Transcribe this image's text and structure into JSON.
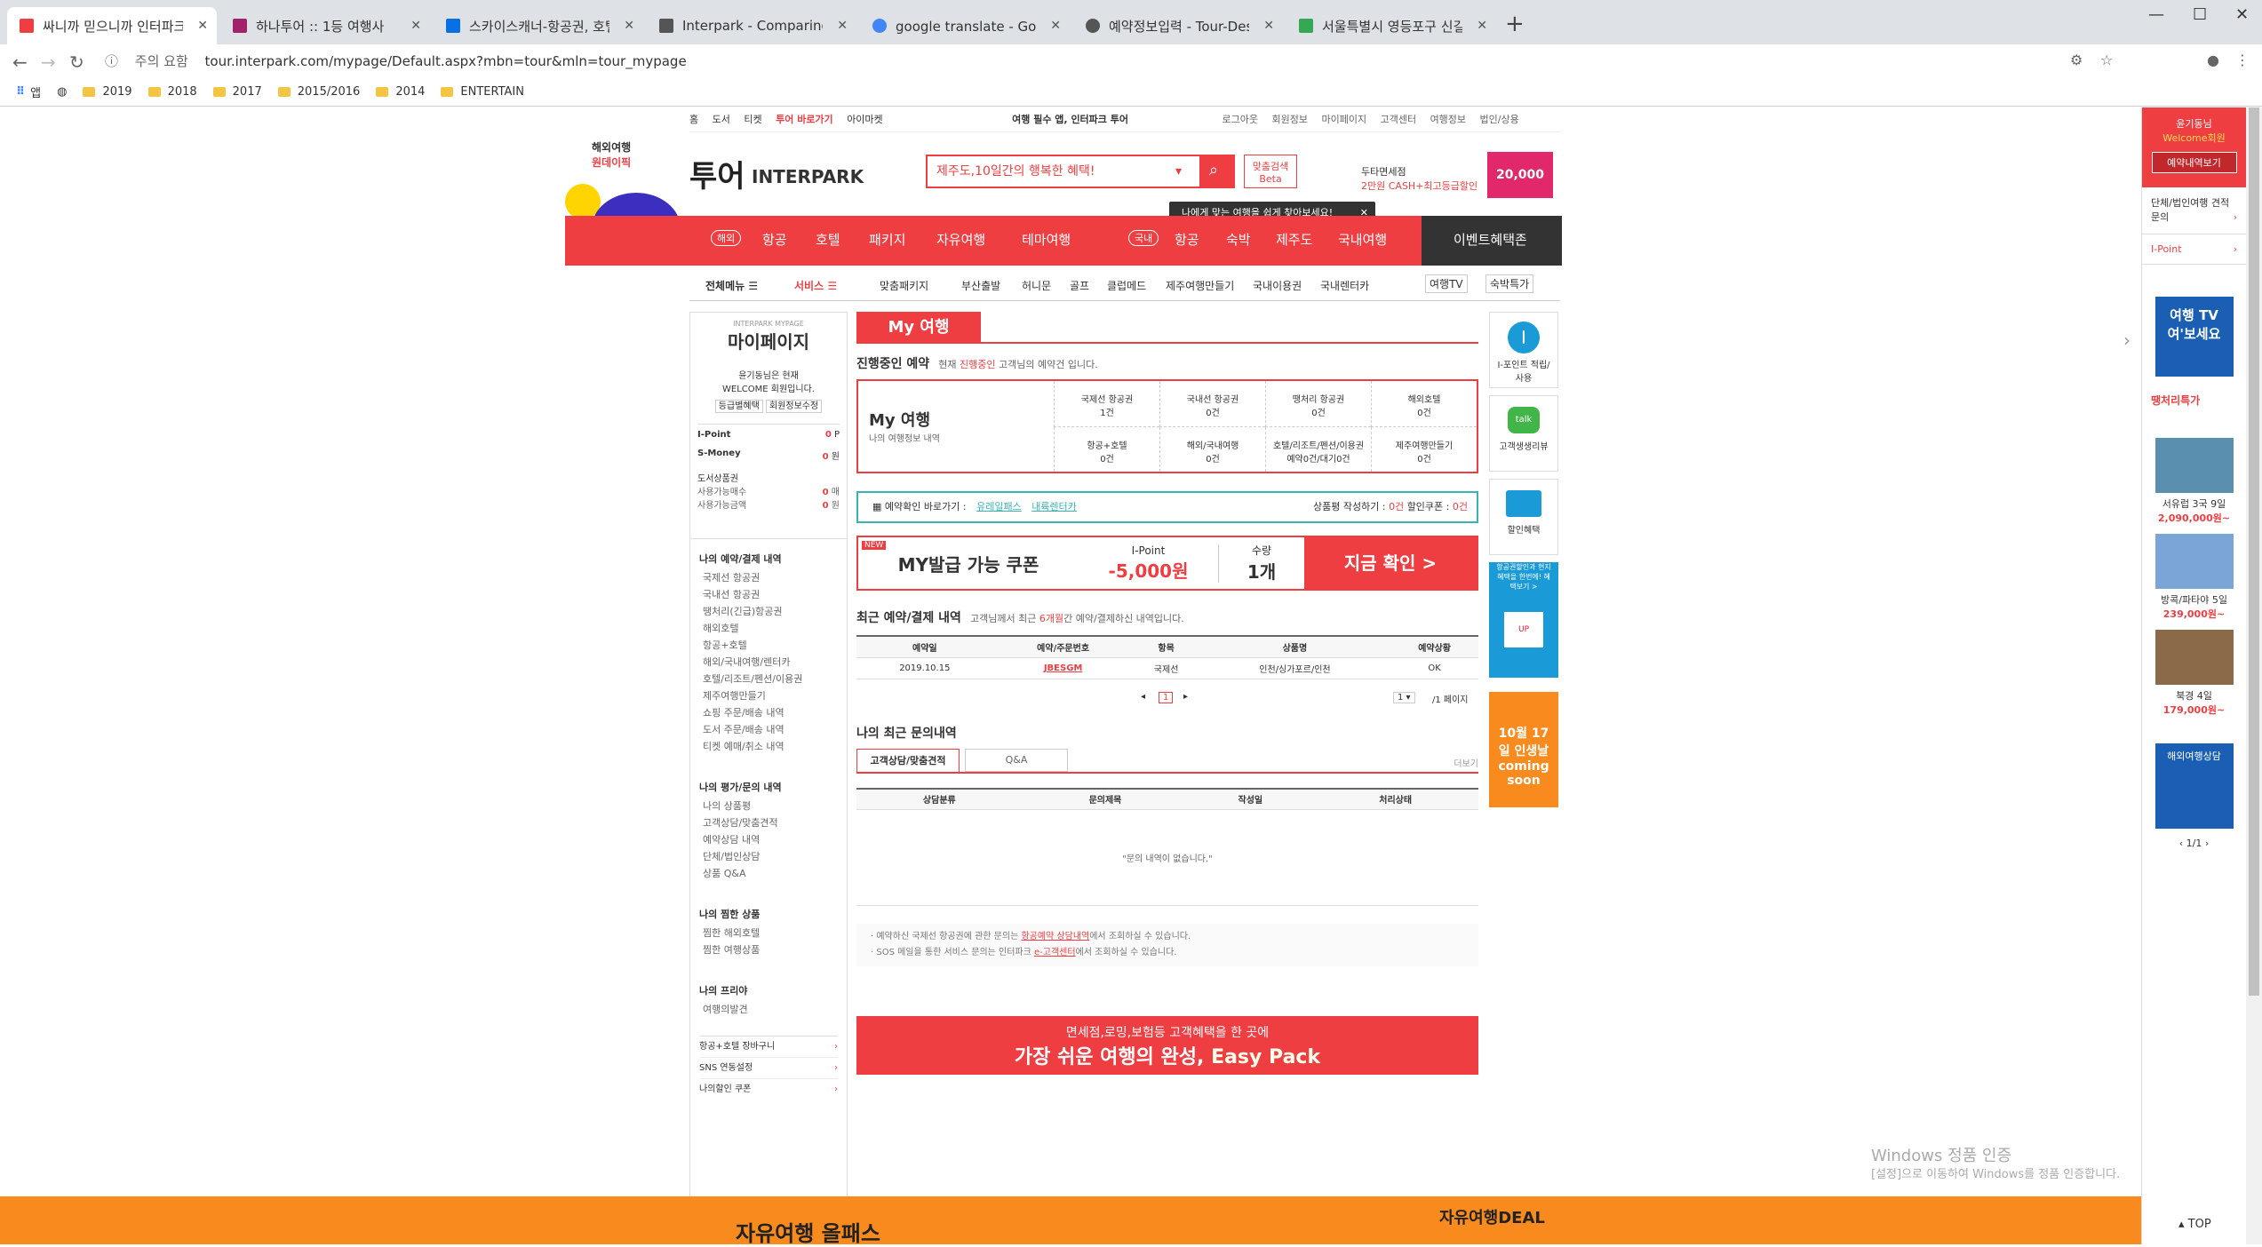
{
  "tabs": [
    {
      "title": "싸니까 믿으니까 인터파크 투어",
      "color": "#ef3e42"
    },
    {
      "title": "하나투어 :: 1등 여행사",
      "color": "#a3206a"
    },
    {
      "title": "스카이스캐너-항공권, 호텔, 렌트",
      "color": "#0770e3"
    },
    {
      "title": "Interpark - Comparing the figur",
      "color": "#555555"
    },
    {
      "title": "google translate - Google 검색",
      "color": "#4285f4"
    },
    {
      "title": "예약정보입력 - Tour-Desktop",
      "color": "#555555"
    },
    {
      "title": "서울특별시 영등포구 신길7동 여",
      "color": "#34a853"
    }
  ],
  "omnibar": {
    "warning": "주의 요함",
    "url": "tour.interpark.com/mypage/Default.aspx?mbn=tour&mln=tour_mypage"
  },
  "bookmarks": [
    "앱",
    "2019",
    "2018",
    "2017",
    "2015/2016",
    "2014",
    "ENTERTAIN"
  ],
  "topbar": {
    "left": [
      "홈",
      "도서",
      "티켓",
      "투어 바로가기",
      "아이마켓"
    ],
    "center": "여행 필수 앱, 인터파크 투어",
    "right": [
      "로그아웃",
      "회원정보",
      "마이페이지",
      "고객센터",
      "여행정보",
      "법인/상용"
    ]
  },
  "header": {
    "logo_text": "투어",
    "brand": "INTERPARK",
    "badge_top": "해외여행",
    "badge_bottom": "원데이픽",
    "search_placeholder": "제주도,10일간의 행복한 혜택!",
    "custom_search": "맞춤검색",
    "beta": "Beta",
    "tooltip": "나에게 맞는 여행을 쉽게 찾아보세요!",
    "promo1": "두타면세점",
    "promo2": "2만원 CASH+최고등급할인",
    "promo_amount": "20,000"
  },
  "mainmenu": {
    "overseas_tag": "해외",
    "overseas": [
      "항공",
      "호텔",
      "패키지",
      "자유여행",
      "테마여행"
    ],
    "domestic_tag": "국내",
    "domestic": [
      "항공",
      "숙박",
      "제주도",
      "국내여행"
    ],
    "event": "이벤트혜택존"
  },
  "submenu": {
    "all": "전체메뉴",
    "service": "서비스",
    "items": [
      "맞춤패키지",
      "부산출발",
      "허니문",
      "골프",
      "클럽메드",
      "제주여행만들기",
      "국내이용권",
      "국내렌터카"
    ],
    "tv": "여행TV",
    "stay": "숙박특가"
  },
  "leftpanel": {
    "title": "마이페이지",
    "title_small": "INTERPARK MYPAGE",
    "welcome1": "윤기동님은 현재",
    "welcome2": "WELCOME 회원입니다.",
    "btn1": "등급별혜택",
    "btn2": "회원정보수정",
    "ipoint_label": "I-Point",
    "ipoint_value": "0",
    "ipoint_unit": "P",
    "smoney_label": "S-Money",
    "smoney_value": "0",
    "smoney_unit": "원",
    "voucher_label": "도서상품권",
    "voucher_a": "사용가능매수",
    "voucher_a_val": "0",
    "voucher_a_unit": "매",
    "voucher_b": "사용가능금액",
    "voucher_b_val": "0",
    "voucher_b_unit": "원",
    "sections": [
      {
        "title": "나의 예약/결제 내역",
        "items": [
          "국제선 항공권",
          "국내선 항공권",
          "땡처리(긴급)항공권",
          "해외호텔",
          "항공+호텔",
          "해외/국내여행/렌터카",
          "호텔/리조트/펜션/이용권",
          "제주여행만들기",
          "쇼핑 주문/배송 내역",
          "도서 주문/배송 내역",
          "티켓 예매/취소 내역"
        ]
      },
      {
        "title": "나의 평가/문의 내역",
        "items": [
          "나의 상품평",
          "고객상담/맞춤견적",
          "예약상담 내역",
          "단체/법인상담",
          "상품 Q&A"
        ]
      },
      {
        "title": "나의 찜한 상품",
        "items": [
          "찜한 해외호텔",
          "찜한 여행상품"
        ]
      },
      {
        "title": "나의 프리야",
        "items": [
          "여행의발견"
        ]
      }
    ],
    "bottom_links": [
      "항공+호텔 장바구니",
      "SNS 연동설정",
      "나의할인 쿠폰"
    ]
  },
  "main": {
    "title": "My 여행",
    "progress_title": "진행중인 예약",
    "progress_desc_pre": "현재 ",
    "progress_desc_red": "진행중인",
    "progress_desc_post": " 고객님의 예약건 입니다.",
    "mytrip_label": "My 여행",
    "mytrip_sub": "나의 여행정보 내역",
    "status_cells": [
      {
        "label": "국제선 항공권",
        "value": "1건"
      },
      {
        "label": "국내선 항공권",
        "value": "0건"
      },
      {
        "label": "땡처리 항공권",
        "value": "0건"
      },
      {
        "label": "해외호텔",
        "value": "0건"
      },
      {
        "label": "항공+호텔",
        "value": "0건"
      },
      {
        "label": "해외/국내여행",
        "value": "0건"
      },
      {
        "label": "호텔/리조트/펜션/이용권",
        "value": "예약0건/대기0건"
      },
      {
        "label": "제주여행만들기",
        "value": "0건"
      }
    ],
    "shortcut_label": "예약확인 바로가기 :",
    "shortcut_links": [
      "유레일패스",
      "내륙렌터카"
    ],
    "review_label": "상품평 작성하기 :",
    "review_value": "0건",
    "coupon_label": "할인쿠폰 :",
    "coupon_value": "0건",
    "coupon_banner": {
      "new": "NEW",
      "title": "MY발급 가능 쿠폰",
      "ipoint": "I-Point",
      "amount": "-5,000원",
      "qty_label": "수량",
      "qty": "1개",
      "cta": "지금 확인 >",
      "ad": "AD"
    },
    "recent_title": "최근 예약/결제 내역",
    "recent_desc_pre": "고객님께서 최근 ",
    "recent_desc_red": "6개월",
    "recent_desc_post": "간 예약/결제하신 내역입니다.",
    "table_headers": [
      "예약일",
      "예약/주문번호",
      "항목",
      "상품명",
      "예약상황"
    ],
    "table_rows": [
      [
        "2019.10.15",
        "JBESGM",
        "국제선",
        "인천/싱가포르/인천",
        "OK"
      ]
    ],
    "pager": "1",
    "page_select": "1",
    "page_total": "/1 페이지",
    "inquiry_title": "나의 최근 문의내역",
    "inquiry_tabs": [
      "고객상담/맞춤견적",
      "Q&A"
    ],
    "more": "더보기",
    "inquiry_headers": [
      "상담분류",
      "문의제목",
      "작성일",
      "처리상태"
    ],
    "inquiry_empty": "\"문의 내역이 없습니다.\"",
    "note1_pre": "예약하신 국제선 항공권에 관한 문의는 ",
    "note1_link": "항공예약 상담내역",
    "note1_post": "에서 조회하실 수 있습니다.",
    "note2_pre": "SOS 메일을 통한 서비스 문의는 인터파크 ",
    "note2_link": "e-고객센터",
    "note2_post": "에서 조회하실 수 있습니다.",
    "easypack_top": "면세점,로밍,보험등 고객혜택을 한 곳에",
    "easypack_main": "가장 쉬운 여행의 완성,",
    "easypack_brand": "Easy Pack"
  },
  "quickbar": [
    {
      "icon": "i-point-icon",
      "label": "I-포인트 적립/사용"
    },
    {
      "icon": "talk-icon",
      "label": "고객생생리뷰"
    },
    {
      "icon": "card-icon",
      "label": "할인혜택"
    },
    {
      "icon": "unionpay-icon",
      "label": "항공권할인과 현지혜택을 한번에! 혜택보기 >"
    },
    {
      "icon": "coming-icon",
      "label": "10월 17일 인생날 coming soon"
    }
  ],
  "rightsidebar": {
    "user": "윤기동님",
    "grade": "Welcome회원",
    "btn": "예약내역보기",
    "links": [
      "단체/법인여행 견적문의",
      "I-Point"
    ],
    "tv_title": "여행 TV 여'보세요",
    "hot_title": "땡처리특가",
    "deals": [
      {
        "name": "서유럽 3국 9일",
        "price": "2,090,000원~"
      },
      {
        "name": "방콕/파타야 5일",
        "price": "239,000원~"
      },
      {
        "name": "북경 4일",
        "price": "179,000원~"
      }
    ],
    "consult": "해외여행상담",
    "pager": "1/1",
    "top": "TOP"
  },
  "footer": {
    "text": "자유여행 올패스",
    "deal": "자유여행DEAL"
  },
  "watermark": {
    "line1": "Windows 정품 인증",
    "line2": "[설정]으로 이동하여 Windows를 정품 인증합니다."
  }
}
